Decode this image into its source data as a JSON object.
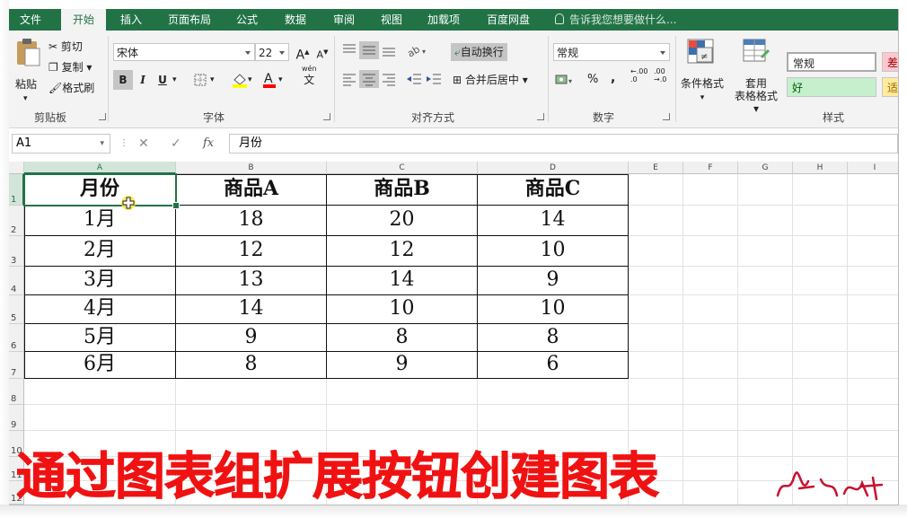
{
  "ribbon_tabs": [
    "文件",
    "开始",
    "插入",
    "页面布局",
    "公式",
    "数据",
    "审阅",
    "视图",
    "加载项",
    "百度网盘"
  ],
  "tell_me": "告诉我您想要做什么...",
  "clipboard": {
    "paste": "粘贴",
    "cut": "剪切",
    "copy": "复制",
    "format_painter": "格式刷",
    "group": "剪贴板"
  },
  "font": {
    "name": "宋体",
    "size": "22",
    "grow": "A",
    "shrink": "A",
    "bold": "B",
    "italic": "I",
    "underline": "U",
    "phonetic_top": "wén",
    "phonetic_bottom": "文",
    "group": "字体"
  },
  "alignment": {
    "wrap": "自动换行",
    "merge": "合并后居中",
    "group": "对齐方式"
  },
  "number": {
    "format": "常规",
    "percent": "%",
    "comma": ",",
    "inc": ".00",
    "dec": ".00",
    "group": "数字"
  },
  "styles": {
    "conditional": "条件格式",
    "table_line1": "套用",
    "table_line2": "表格格式",
    "normal": "常规",
    "good": "好",
    "bad": "差",
    "neutral": "适",
    "group": "样式"
  },
  "formula_bar": {
    "name_box": "A1",
    "fx": "fx",
    "content": "月份"
  },
  "columns": [
    "A",
    "B",
    "C",
    "D",
    "E",
    "F",
    "G",
    "H",
    "I"
  ],
  "rows": [
    "1",
    "2",
    "3",
    "4",
    "5",
    "6",
    "7",
    "8",
    "9",
    "10",
    "11",
    "12"
  ],
  "table": {
    "header": [
      "月份",
      "商品A",
      "商品B",
      "商品C"
    ],
    "rows": [
      [
        "1月",
        "18",
        "20",
        "14"
      ],
      [
        "2月",
        "12",
        "12",
        "10"
      ],
      [
        "3月",
        "13",
        "14",
        "9"
      ],
      [
        "4月",
        "14",
        "10",
        "10"
      ],
      [
        "5月",
        "9",
        "8",
        "8"
      ],
      [
        "6月",
        "8",
        "9",
        "6"
      ]
    ]
  },
  "caption": "通过图表组扩展按钮创建图表",
  "colors": {
    "excel_green": "#217346",
    "caption_red": "#f01212",
    "good_fill": "#c6efce",
    "bad_fill": "#ffc7ce",
    "neutral_fill": "#ffeb9c"
  }
}
